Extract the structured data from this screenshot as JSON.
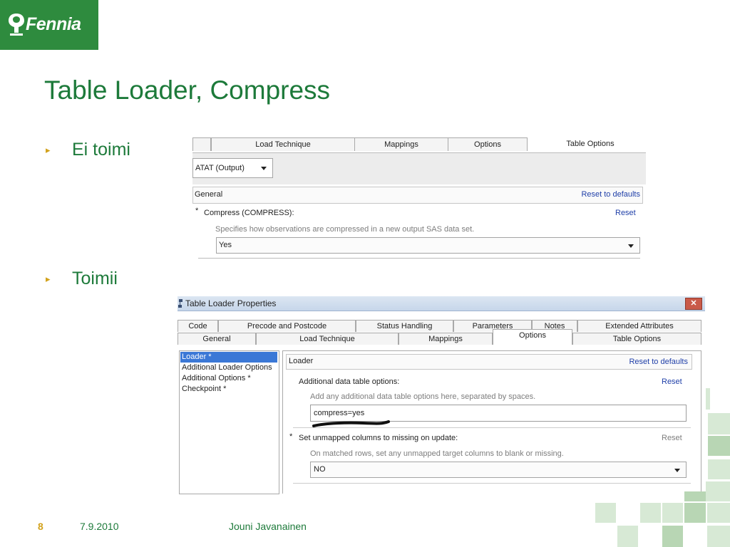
{
  "slide": {
    "logo_text": "Fennia",
    "title": "Table Loader, Compress",
    "bullets": [
      "Ei toimi",
      "Toimii"
    ],
    "bullet_marker": "▸",
    "footer": {
      "page_number": "8",
      "date": "7.9.2010",
      "author": "Jouni Javanainen"
    },
    "colors": {
      "brand_green": "#2e8b3e",
      "title_green": "#1d7a3a",
      "accent_gold": "#d2a21c",
      "square_light": "#d7e9d5",
      "square_mid": "#b8d6b4"
    }
  },
  "screenshot1": {
    "tabs": [
      "Load Technique",
      "Mappings",
      "Options",
      "Table Options"
    ],
    "active_tab": "Table Options",
    "table_combo": "ATAT (Output)",
    "section_label": "General",
    "reset_defaults_label": "Reset to defaults",
    "field_required_mark": "*",
    "field_label": "Compress (COMPRESS):",
    "field_reset_label": "Reset",
    "field_hint": "Specifies how observations are compressed in a new output SAS data set.",
    "field_value": "Yes"
  },
  "screenshot2": {
    "window_title": "Table Loader Properties",
    "close_symbol": "✕",
    "tabs_top_row": [
      "Code",
      "Precode and Postcode",
      "Status Handling",
      "Parameters",
      "Notes",
      "Extended Attributes"
    ],
    "tabs_bottom_row": [
      "General",
      "Load Technique",
      "Mappings",
      "Options",
      "Table Options"
    ],
    "active_tab": "Options",
    "nav_items": [
      "Loader *",
      "Additional Loader Options",
      "Additional Options *",
      "Checkpoint *"
    ],
    "selected_nav": "Loader *",
    "section_label": "Loader",
    "reset_defaults_label": "Reset to defaults",
    "field1": {
      "label": "Additional data table options:",
      "reset_label": "Reset",
      "hint": "Add any additional data table options here, separated by spaces.",
      "value": "compress=yes"
    },
    "field2": {
      "required_mark": "*",
      "label": "Set unmapped columns to missing on update:",
      "reset_label": "Reset",
      "hint": "On matched rows, set any unmapped target columns to blank or missing.",
      "value": "NO"
    }
  }
}
